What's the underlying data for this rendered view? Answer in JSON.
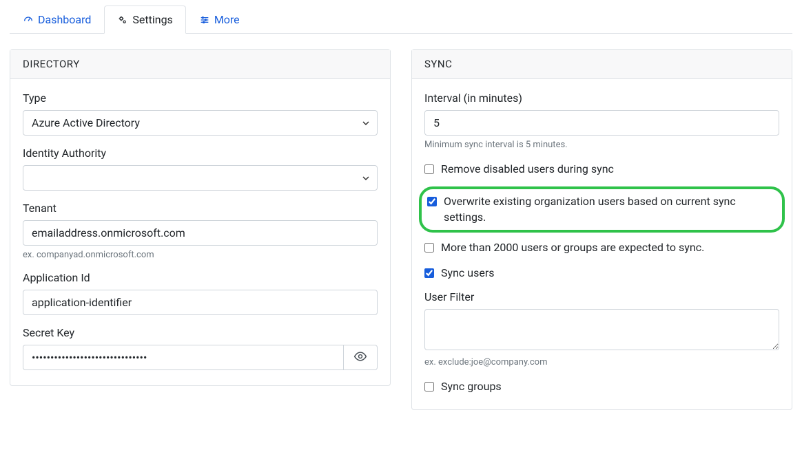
{
  "tabs": {
    "dashboard": "Dashboard",
    "settings": "Settings",
    "more": "More"
  },
  "directory": {
    "header": "DIRECTORY",
    "type_label": "Type",
    "type_value": "Azure Active Directory",
    "identity_authority_label": "Identity Authority",
    "identity_authority_value": "",
    "tenant_label": "Tenant",
    "tenant_value": "emailaddress.onmicrosoft.com",
    "tenant_help": "ex. companyad.onmicrosoft.com",
    "app_id_label": "Application Id",
    "app_id_value": "application-identifier",
    "secret_key_label": "Secret Key",
    "secret_key_value": "•••••••••••••••••••••••••••••••"
  },
  "sync": {
    "header": "SYNC",
    "interval_label": "Interval (in minutes)",
    "interval_value": "5",
    "interval_help": "Minimum sync interval is 5 minutes.",
    "remove_disabled_label": "Remove disabled users during sync",
    "remove_disabled_checked": false,
    "overwrite_label": "Overwrite existing organization users based on current sync settings.",
    "overwrite_checked": true,
    "more_than_2000_label": "More than 2000 users or groups are expected to sync.",
    "more_than_2000_checked": false,
    "sync_users_label": "Sync users",
    "sync_users_checked": true,
    "user_filter_label": "User Filter",
    "user_filter_value": "",
    "user_filter_help": "ex. exclude:joe@company.com",
    "sync_groups_label": "Sync groups",
    "sync_groups_checked": false
  }
}
